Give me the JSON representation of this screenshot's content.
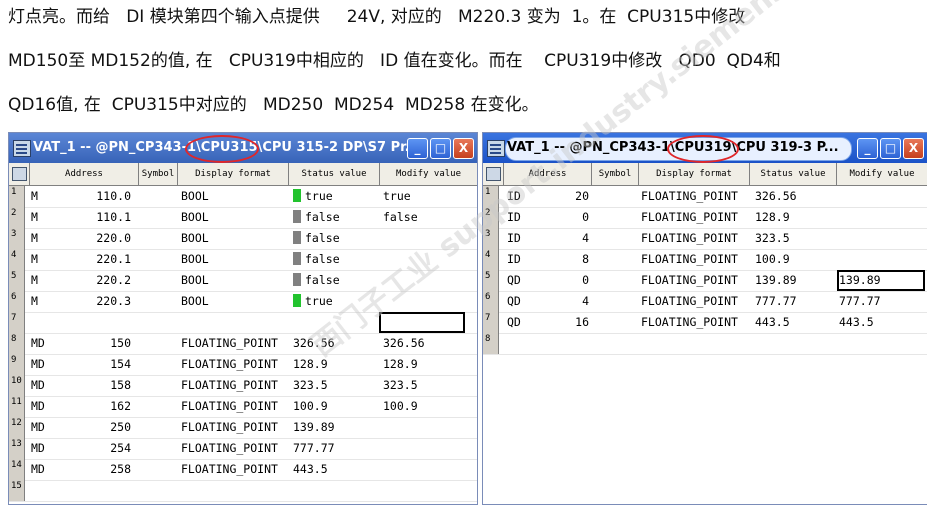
{
  "document": {
    "lines": [
      "灯点亮。而给   DI 模块第四个输入点提供     24V, 对应的   M220.3 变为  1。在  CPU315中修改",
      "MD150至 MD152的值, 在   CPU319中相应的   ID 值在变化。而在    CPU319中修改   QD0  QD4和",
      "QD16值, 在  CPU315中对应的   MD250  MD254  MD258 在变化。"
    ]
  },
  "left_window": {
    "title_part1": "VAT_1 -- @PN_CP343-1\\",
    "title_highlight": "CPU315\\",
    "title_part2": "CPU 315-2 DP\\S7 Pr...",
    "columns": [
      "Address",
      "Symbol",
      "Display format",
      "Status value",
      "Modify value"
    ],
    "rows": [
      {
        "num": "1",
        "op": "M",
        "addr": "110.0",
        "symbol": "",
        "format": "BOOL",
        "status": "true",
        "modify": "true",
        "indicator": "green"
      },
      {
        "num": "2",
        "op": "M",
        "addr": "110.1",
        "symbol": "",
        "format": "BOOL",
        "status": "false",
        "modify": "false",
        "indicator": "gray"
      },
      {
        "num": "3",
        "op": "M",
        "addr": "220.0",
        "symbol": "",
        "format": "BOOL",
        "status": "false",
        "modify": "",
        "indicator": "gray"
      },
      {
        "num": "4",
        "op": "M",
        "addr": "220.1",
        "symbol": "",
        "format": "BOOL",
        "status": "false",
        "modify": "",
        "indicator": "gray"
      },
      {
        "num": "5",
        "op": "M",
        "addr": "220.2",
        "symbol": "",
        "format": "BOOL",
        "status": "false",
        "modify": "",
        "indicator": "gray"
      },
      {
        "num": "6",
        "op": "M",
        "addr": "220.3",
        "symbol": "",
        "format": "BOOL",
        "status": "true",
        "modify": "",
        "indicator": "green"
      },
      {
        "num": "7",
        "op": "",
        "addr": "",
        "symbol": "",
        "format": "",
        "status": "",
        "modify": "",
        "indicator": ""
      },
      {
        "num": "8",
        "op": "MD",
        "addr": "150",
        "symbol": "",
        "format": "FLOATING_POINT",
        "status": "326.56",
        "modify": "326.56",
        "indicator": ""
      },
      {
        "num": "9",
        "op": "MD",
        "addr": "154",
        "symbol": "",
        "format": "FLOATING_POINT",
        "status": "128.9",
        "modify": "128.9",
        "indicator": ""
      },
      {
        "num": "10",
        "op": "MD",
        "addr": "158",
        "symbol": "",
        "format": "FLOATING_POINT",
        "status": "323.5",
        "modify": "323.5",
        "indicator": ""
      },
      {
        "num": "11",
        "op": "MD",
        "addr": "162",
        "symbol": "",
        "format": "FLOATING_POINT",
        "status": "100.9",
        "modify": "100.9",
        "indicator": ""
      },
      {
        "num": "12",
        "op": "MD",
        "addr": "250",
        "symbol": "",
        "format": "FLOATING_POINT",
        "status": "139.89",
        "modify": "",
        "indicator": ""
      },
      {
        "num": "13",
        "op": "MD",
        "addr": "254",
        "symbol": "",
        "format": "FLOATING_POINT",
        "status": "777.77",
        "modify": "",
        "indicator": ""
      },
      {
        "num": "14",
        "op": "MD",
        "addr": "258",
        "symbol": "",
        "format": "FLOATING_POINT",
        "status": "443.5",
        "modify": "",
        "indicator": ""
      },
      {
        "num": "15",
        "op": "",
        "addr": "",
        "symbol": "",
        "format": "",
        "status": "",
        "modify": "",
        "indicator": ""
      }
    ]
  },
  "right_window": {
    "title_part1": "VAT_1 -- @PN_CP343-1\\",
    "title_highlight": "CPU319\\",
    "title_part2": "CPU 319-3 P...",
    "columns": [
      "Address",
      "Symbol",
      "Display format",
      "Status value",
      "Modify value"
    ],
    "rows": [
      {
        "num": "1",
        "op": "ID",
        "addr": "20",
        "symbol": "",
        "format": "FLOATING_POINT",
        "status": "326.56",
        "modify": ""
      },
      {
        "num": "2",
        "op": "ID",
        "addr": "0",
        "symbol": "",
        "format": "FLOATING_POINT",
        "status": "128.9",
        "modify": ""
      },
      {
        "num": "3",
        "op": "ID",
        "addr": "4",
        "symbol": "",
        "format": "FLOATING_POINT",
        "status": "323.5",
        "modify": ""
      },
      {
        "num": "4",
        "op": "ID",
        "addr": "8",
        "symbol": "",
        "format": "FLOATING_POINT",
        "status": "100.9",
        "modify": ""
      },
      {
        "num": "5",
        "op": "QD",
        "addr": "0",
        "symbol": "",
        "format": "FLOATING_POINT",
        "status": "139.89",
        "modify": "139.89"
      },
      {
        "num": "6",
        "op": "QD",
        "addr": "4",
        "symbol": "",
        "format": "FLOATING_POINT",
        "status": "777.77",
        "modify": "777.77"
      },
      {
        "num": "7",
        "op": "QD",
        "addr": "16",
        "symbol": "",
        "format": "FLOATING_POINT",
        "status": "443.5",
        "modify": "443.5"
      },
      {
        "num": "8",
        "op": "",
        "addr": "",
        "symbol": "",
        "format": "",
        "status": "",
        "modify": ""
      }
    ]
  },
  "window_buttons": {
    "minimize": "_",
    "maximize": "□",
    "close": "X"
  },
  "watermark": "西门子工业 support.industry.siemens.com",
  "colors": {
    "indicator_green": "#22c32e",
    "indicator_gray": "#808080",
    "status_bg": "#c0c0c0",
    "highlight": "#e0262a"
  }
}
